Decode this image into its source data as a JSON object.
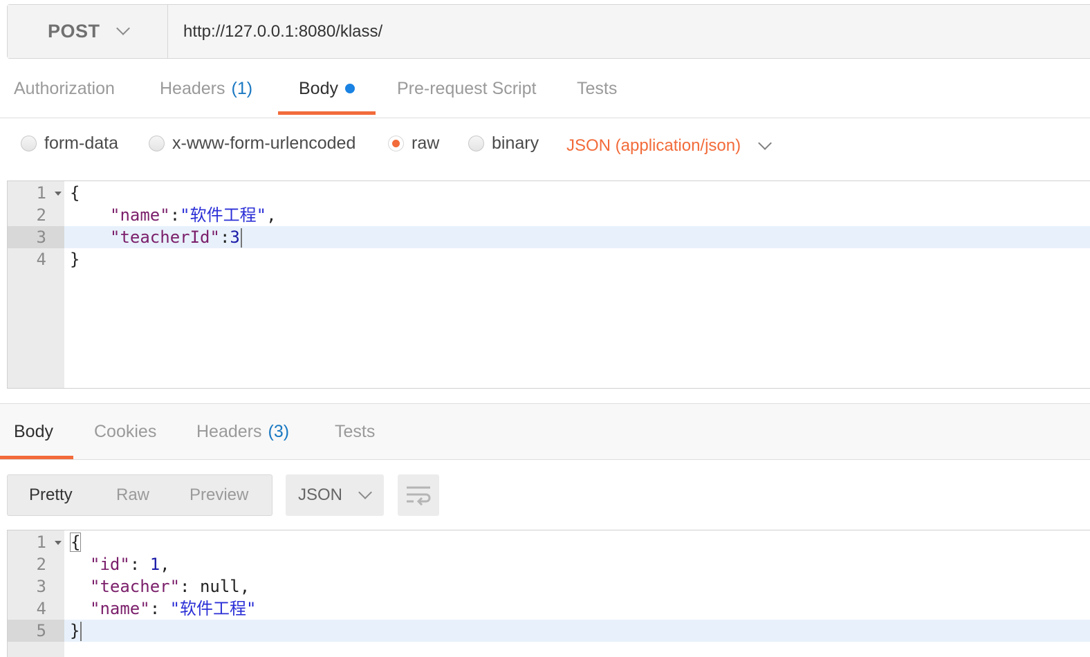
{
  "request": {
    "method": "POST",
    "url": "http://127.0.0.1:8080/klass/"
  },
  "request_tabs": {
    "authorization": "Authorization",
    "headers": "Headers",
    "headers_count": "(1)",
    "body": "Body",
    "pre_request": "Pre-request Script",
    "tests": "Tests",
    "active": "Body"
  },
  "body_modes": {
    "form_data": "form-data",
    "urlencoded": "x-www-form-urlencoded",
    "raw": "raw",
    "binary": "binary",
    "selected": "raw",
    "content_type": "JSON (application/json)"
  },
  "request_editor": {
    "line_numbers": [
      "1",
      "2",
      "3",
      "4"
    ],
    "active_line": "3",
    "lines": {
      "l1": "{",
      "l2_key": "\"name\"",
      "l2_sep": ":",
      "l2_val": "\"软件工程\"",
      "l2_end": ",",
      "l3_key": "\"teacherId\"",
      "l3_sep": ":",
      "l3_val": "3",
      "l4": "}"
    }
  },
  "response_tabs": {
    "body": "Body",
    "cookies": "Cookies",
    "headers": "Headers",
    "headers_count": "(3)",
    "tests": "Tests",
    "active": "Body"
  },
  "response_view": {
    "pretty": "Pretty",
    "raw": "Raw",
    "preview": "Preview",
    "selected": "Pretty",
    "format": "JSON",
    "wrap_icon": "wrap-lines-icon"
  },
  "response_editor": {
    "line_numbers": [
      "1",
      "2",
      "3",
      "4",
      "5"
    ],
    "active_line": "5",
    "lines": {
      "l1": "{",
      "l2_key": "\"id\"",
      "l2_sep": ": ",
      "l2_val": "1",
      "l2_end": ",",
      "l3_key": "\"teacher\"",
      "l3_sep": ": ",
      "l3_val": "null",
      "l3_end": ",",
      "l4_key": "\"name\"",
      "l4_sep": ": ",
      "l4_val": "\"软件工程\"",
      "l5": "}"
    }
  },
  "colors": {
    "accent_orange": "#f26b3a",
    "count_blue": "#1a78c2",
    "dot_blue": "#1a82e2",
    "json_key": "#7b1f6b",
    "json_string": "#2b2fd6"
  }
}
